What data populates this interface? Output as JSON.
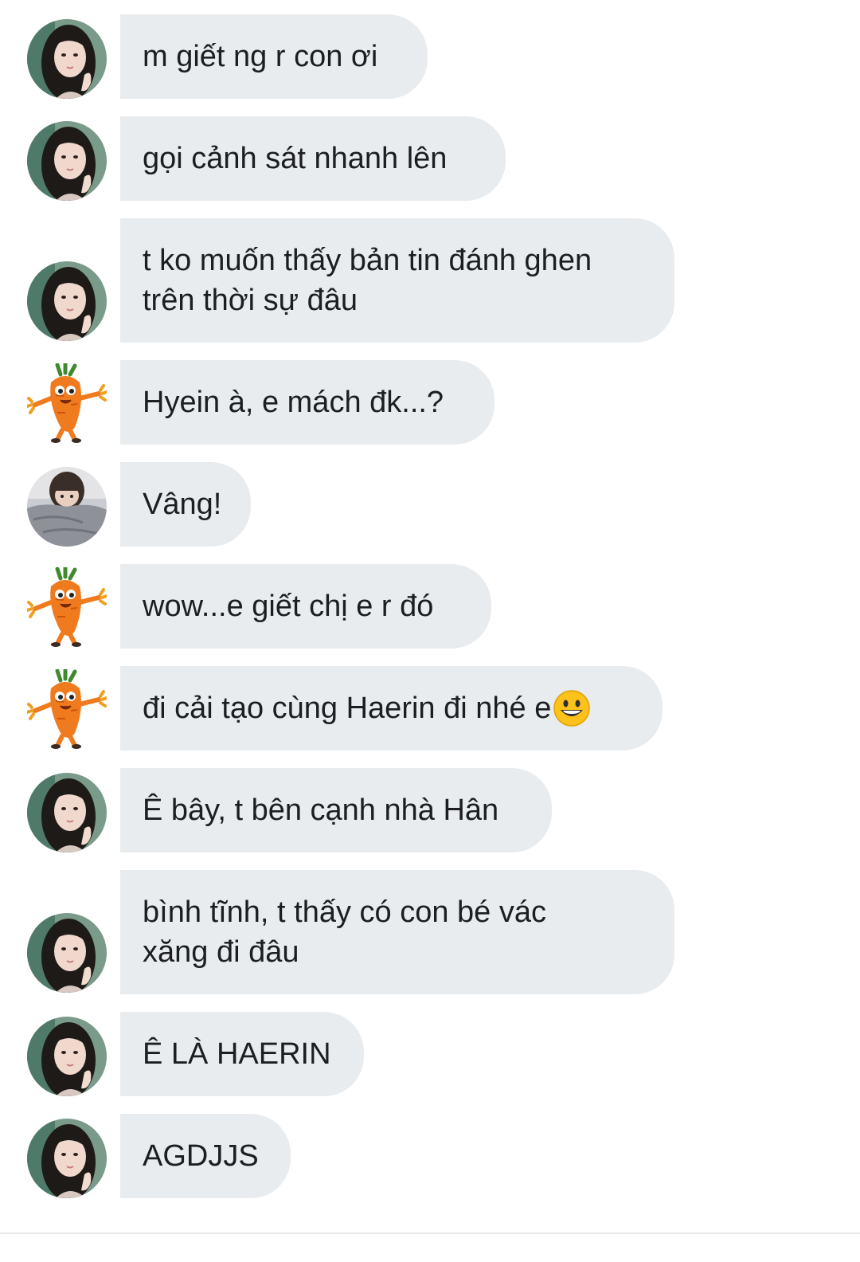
{
  "conversation": {
    "messages": [
      {
        "sender": "girl",
        "text": "m giết ng r con ơi"
      },
      {
        "sender": "girl",
        "text": "gọi cảnh sát nhanh lên"
      },
      {
        "sender": "girl",
        "text": "t ko muốn thấy bản tin đánh ghen\ntrên thời sự đâu"
      },
      {
        "sender": "carrot",
        "text": "Hyein à, e mách đk...?"
      },
      {
        "sender": "bed",
        "text": "Vâng!"
      },
      {
        "sender": "carrot",
        "text": "wow...e giết chị e r đó"
      },
      {
        "sender": "carrot",
        "text": "đi cải tạo cùng Haerin đi nhé e",
        "emoji": "grinning-face-emoji"
      },
      {
        "sender": "girl",
        "text": "Ê bây, t bên cạnh nhà Hân"
      },
      {
        "sender": "girl",
        "text": "bình tĩnh, t thấy có con bé vác\nxăng đi đâu"
      },
      {
        "sender": "girl",
        "text": "Ê LÀ HAERIN"
      },
      {
        "sender": "girl",
        "text": "AGDJJS"
      }
    ]
  },
  "colors": {
    "bubble_background": "#e9ecef",
    "text": "#1c1e21",
    "page_background": "#ffffff"
  }
}
